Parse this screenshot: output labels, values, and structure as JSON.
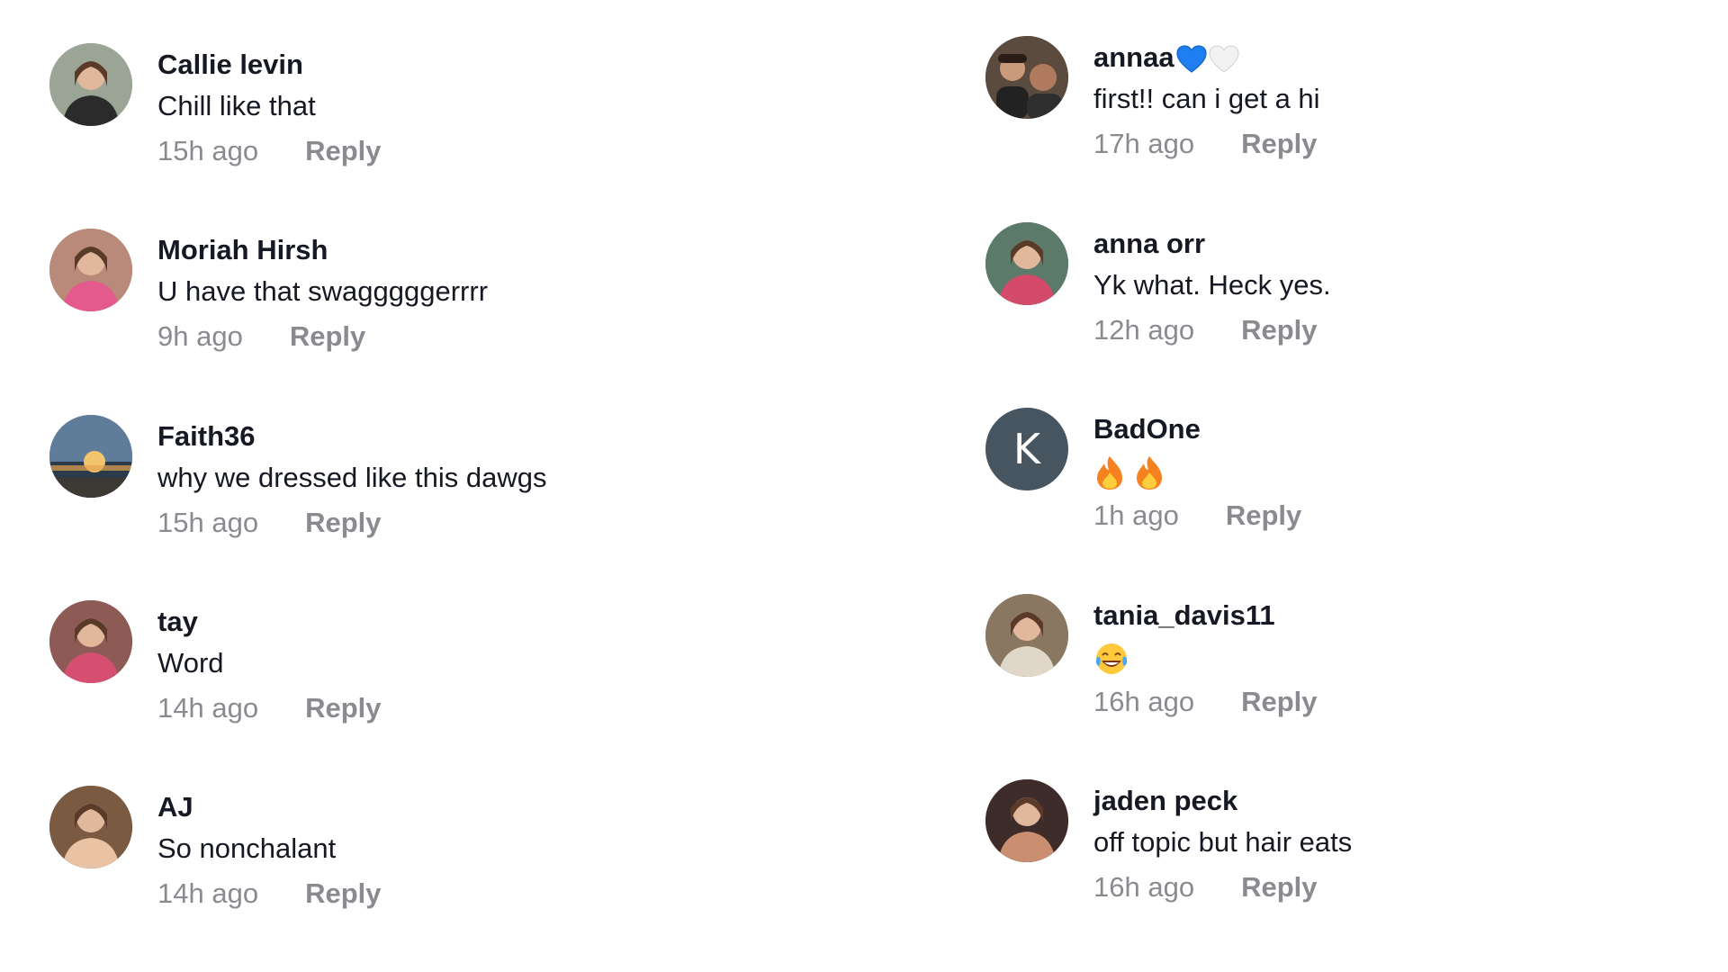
{
  "left": [
    {
      "username": "Callie levin",
      "text": "Chill like that",
      "time": "15h ago",
      "reply": "Reply",
      "avatar": {
        "icon": "profile-photo",
        "bg": "#9aa596",
        "fg": "#2b2b2b"
      }
    },
    {
      "username": "Moriah Hirsh",
      "text": "U have that swagggggerrrr",
      "time": "9h ago",
      "reply": "Reply",
      "avatar": {
        "icon": "profile-photo",
        "bg": "#b9897a",
        "fg": "#e55a8c"
      }
    },
    {
      "username": "Faith36",
      "text": "why we dressed like this dawgs",
      "time": "15h ago",
      "reply": "Reply",
      "avatar": {
        "icon": "sunset-photo",
        "bg": "#5f7d9a",
        "fg": "#f2c46b"
      }
    },
    {
      "username": "tay",
      "text": "Word",
      "time": "14h ago",
      "reply": "Reply",
      "avatar": {
        "icon": "profile-photo",
        "bg": "#8d5a55",
        "fg": "#d64f71"
      }
    },
    {
      "username": "AJ",
      "text": "So nonchalant",
      "time": "14h ago",
      "reply": "Reply",
      "avatar": {
        "icon": "profile-photo",
        "bg": "#7a5a41",
        "fg": "#e9c3a4"
      }
    }
  ],
  "right": [
    {
      "username": "annaa",
      "text": "first!! can i get a hi",
      "time": "17h ago",
      "reply": "Reply",
      "hearts": [
        "blue-heart-icon",
        "white-heart-icon"
      ],
      "avatar": {
        "icon": "group-photo",
        "bg": "#5b4b3f",
        "fg": "#c99b7b"
      }
    },
    {
      "username": "anna orr",
      "text": "Yk what. Heck yes.",
      "time": "12h ago",
      "reply": "Reply",
      "avatar": {
        "icon": "profile-photo",
        "bg": "#5c7a6a",
        "fg": "#d34a6a"
      }
    },
    {
      "username": "BadOne",
      "text": "",
      "emojis": [
        "fire-icon",
        "fire-icon"
      ],
      "time": "1h ago",
      "reply": "Reply",
      "avatar": {
        "icon": "letter-avatar",
        "letter": "K",
        "bg": "#46555f",
        "fg": "#ffffff"
      }
    },
    {
      "username": "tania_davis11",
      "text": "",
      "emojis": [
        "laughing-crying-icon"
      ],
      "time": "16h ago",
      "reply": "Reply",
      "avatar": {
        "icon": "profile-photo",
        "bg": "#8a7762",
        "fg": "#e1d7c8"
      }
    },
    {
      "username": "jaden peck",
      "text": "off topic but hair eats",
      "time": "16h ago",
      "reply": "Reply",
      "avatar": {
        "icon": "profile-photo",
        "bg": "#3e2c2a",
        "fg": "#c98f70"
      }
    }
  ],
  "colors": {
    "username": "#161823",
    "text": "#161823",
    "meta": "#8a8b91",
    "blue_heart": "#1f7ff0",
    "white_heart": "#f2f2f2",
    "fire_outer": "#f5811f",
    "fire_inner": "#ffce3d",
    "laugh_face": "#ffc83d"
  }
}
